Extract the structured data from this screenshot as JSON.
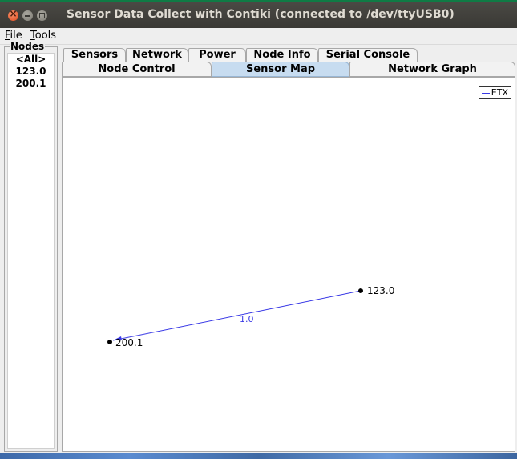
{
  "window": {
    "title": "Sensor Data Collect with Contiki (connected to /dev/ttyUSB0)"
  },
  "menu": {
    "items": [
      {
        "mnemonic": "F",
        "rest": "ile"
      },
      {
        "mnemonic": "T",
        "rest": "ools"
      }
    ]
  },
  "nodes": {
    "title": "Nodes",
    "items": [
      "<All>",
      "123.0",
      "200.1"
    ]
  },
  "tabs": {
    "row1": [
      "Sensors",
      "Network",
      "Power",
      "Node Info",
      "Serial Console"
    ],
    "row2": [
      "Node Control",
      "Sensor Map",
      "Network Graph"
    ],
    "active": "Sensor Map"
  },
  "map": {
    "legend": "ETX",
    "link_color": "#3a3ae6",
    "nodes": [
      {
        "id": "123.0"
      },
      {
        "id": "200.1"
      }
    ],
    "links": [
      {
        "from": "200.1",
        "to": "123.0",
        "label": "1.0"
      }
    ]
  },
  "colors": {
    "titlebar": "#3a3935",
    "active_tab": "#c7dcf0",
    "accent_green": "#0f7b45"
  }
}
